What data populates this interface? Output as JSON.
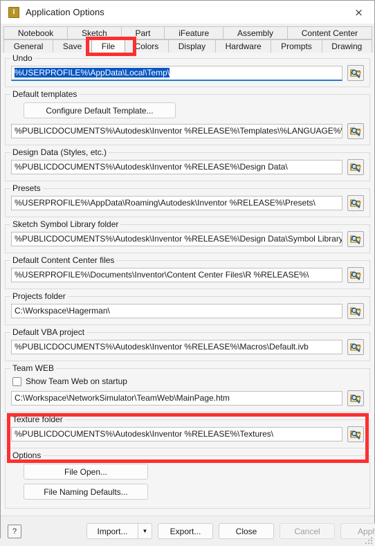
{
  "window": {
    "title": "Application Options",
    "app_icon_glyph": "I",
    "close_label": "×"
  },
  "tabs": {
    "row1": [
      {
        "label": "Notebook",
        "active": false
      },
      {
        "label": "Sketch",
        "active": false
      },
      {
        "label": "Part",
        "active": false
      },
      {
        "label": "iFeature",
        "active": false
      },
      {
        "label": "Assembly",
        "active": false
      },
      {
        "label": "Content Center",
        "active": false
      }
    ],
    "row2": [
      {
        "label": "General",
        "active": false
      },
      {
        "label": "Save",
        "active": false
      },
      {
        "label": "File",
        "active": true
      },
      {
        "label": "Colors",
        "active": false
      },
      {
        "label": "Display",
        "active": false
      },
      {
        "label": "Hardware",
        "active": false
      },
      {
        "label": "Prompts",
        "active": false
      },
      {
        "label": "Drawing",
        "active": false
      }
    ]
  },
  "groups": {
    "undo": {
      "legend": "Undo",
      "value": "%USERPROFILE%\\AppData\\Local\\Temp\\",
      "selected": true,
      "browse_label": "browse"
    },
    "default_templates": {
      "legend": "Default templates",
      "button_label": "Configure Default Template...",
      "value": "%PUBLICDOCUMENTS%\\Autodesk\\Inventor %RELEASE%\\Templates\\%LANGUAGE%\\"
    },
    "design_data": {
      "legend": "Design Data (Styles, etc.)",
      "value": "%PUBLICDOCUMENTS%\\Autodesk\\Inventor %RELEASE%\\Design Data\\"
    },
    "presets": {
      "legend": "Presets",
      "value": "%USERPROFILE%\\AppData\\Roaming\\Autodesk\\Inventor %RELEASE%\\Presets\\"
    },
    "sketch_symbol": {
      "legend": "Sketch Symbol Library folder",
      "value": "%PUBLICDOCUMENTS%\\Autodesk\\Inventor %RELEASE%\\Design Data\\Symbol Library\\"
    },
    "content_center": {
      "legend": "Default Content Center files",
      "value": "%USERPROFILE%\\Documents\\Inventor\\Content Center Files\\R %RELEASE%\\"
    },
    "projects": {
      "legend": "Projects folder",
      "value": "C:\\Workspace\\Hagerman\\"
    },
    "vba": {
      "legend": "Default VBA project",
      "value": "%PUBLICDOCUMENTS%\\Autodesk\\Inventor %RELEASE%\\Macros\\Default.ivb"
    },
    "team_web": {
      "legend": "Team WEB",
      "checkbox_label": "Show Team Web on startup",
      "checkbox_checked": false,
      "value": "C:\\Workspace\\NetworkSimulator\\TeamWeb\\MainPage.htm"
    },
    "texture": {
      "legend": "Texture folder",
      "value": "%PUBLICDOCUMENTS%\\Autodesk\\Inventor %RELEASE%\\Textures\\"
    },
    "options": {
      "legend": "Options",
      "file_open_label": "File Open...",
      "file_naming_label": "File Naming Defaults..."
    }
  },
  "footer": {
    "help_label": "?",
    "import_label": "Import...",
    "import_arrow": "▼",
    "export_label": "Export...",
    "close_label": "Close",
    "cancel_label": "Cancel",
    "apply_label": "Apply",
    "cancel_disabled": true,
    "apply_disabled": true
  },
  "annotations": {
    "highlight_color": "#fc3030",
    "file_tab_highlight": "File",
    "team_web_highlight": "Team WEB"
  }
}
